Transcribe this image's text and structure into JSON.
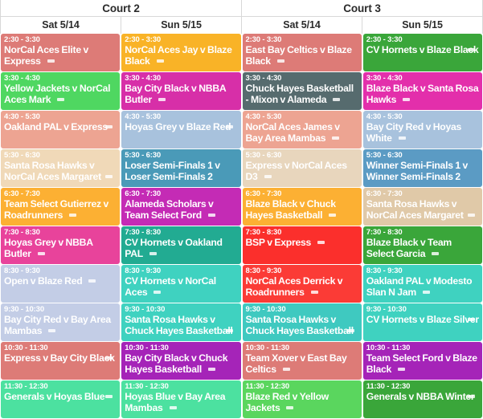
{
  "courts": [
    {
      "name": "Court 2"
    },
    {
      "name": "Court 3"
    }
  ],
  "days": [
    {
      "label": "Sat 5/14"
    },
    {
      "label": "Sun 5/15"
    },
    {
      "label": "Sat 5/14"
    },
    {
      "label": "Sun 5/15"
    }
  ],
  "marker_symbol": "=",
  "columns": [
    {
      "court": "Court 2",
      "day": "Sat 5/14",
      "games": [
        {
          "time": "2:30 - 3:30",
          "title": "NorCal Aces Elite v Express",
          "color": "#dd7b77",
          "marker": true
        },
        {
          "time": "3:30 - 4:30",
          "title": "Yellow Jackets v NorCal Aces Mark",
          "color": "#4fd761",
          "marker": true
        },
        {
          "time": "4:30 - 5:30",
          "title": "Oakland PAL v Express",
          "color": "#eda492",
          "marker": true
        },
        {
          "time": "5:30 - 6:30",
          "title": "Santa Rosa Hawks v NorCal Aces Margaret",
          "color": "#f0d9b8",
          "marker": true
        },
        {
          "time": "6:30 - 7:30",
          "title": "Team Select Gutierrez v Roadrunners",
          "color": "#fcb033",
          "marker": true
        },
        {
          "time": "7:30 - 8:30",
          "title": "Hoyas Grey v NBBA Butler",
          "color": "#e8439b",
          "marker": true
        },
        {
          "time": "8:30 - 9:30",
          "title": "Open v Blaze Red",
          "color": "#c3cde6",
          "marker": true
        },
        {
          "time": "9:30 - 10:30",
          "title": "Bay City Red v Bay Area Mambas",
          "color": "#c3cde6",
          "marker": true
        },
        {
          "time": "10:30 - 11:30",
          "title": "Express v Bay City Black",
          "color": "#dd7b77",
          "marker": true
        },
        {
          "time": "11:30 - 12:30",
          "title": "Generals v Hoyas Blue",
          "color": "#4ce1a0",
          "marker": true
        }
      ]
    },
    {
      "court": "Court 2",
      "day": "Sun 5/15",
      "games": [
        {
          "time": "2:30 - 3:30",
          "title": "NorCal Aces Jay v Blaze Black",
          "color": "#f9b327",
          "marker": true
        },
        {
          "time": "3:30 - 4:30",
          "title": "Bay City Black v NBBA Butler",
          "color": "#d72fa8",
          "marker": true
        },
        {
          "time": "4:30 - 5:30",
          "title": "Hoyas Grey v Blaze Red",
          "color": "#a8c2dd",
          "marker": true
        },
        {
          "time": "5:30 - 6:30",
          "title": "Loser Semi-Finals 1 v Loser Semi-Finals 2",
          "color": "#4a9ab8",
          "marker": false
        },
        {
          "time": "6:30 - 7:30",
          "title": "Alameda Scholars v Team Select Ford",
          "color": "#c42bb5",
          "marker": true
        },
        {
          "time": "7:30 - 8:30",
          "title": "CV Hornets v Oakland PAL",
          "color": "#22ab92",
          "marker": true
        },
        {
          "time": "8:30 - 9:30",
          "title": "CV Hornets v NorCal Aces",
          "color": "#3fd2c0",
          "marker": true
        },
        {
          "time": "9:30 - 10:30",
          "title": "Santa Rosa Hawks v Chuck Hayes Basketball",
          "color": "#3fd2c0",
          "marker": true
        },
        {
          "time": "10:30 - 11:30",
          "title": "Bay City Black v Chuck Hayes Basketball",
          "color": "#a524b8",
          "marker": true
        },
        {
          "time": "11:30 - 12:30",
          "title": "Hoyas Blue v Bay Area Mambas",
          "color": "#4ce1a0",
          "marker": true
        }
      ]
    },
    {
      "court": "Court 3",
      "day": "Sat 5/14",
      "games": [
        {
          "time": "2:30 - 3:30",
          "title": "East Bay Celtics v Blaze Black",
          "color": "#dd7b77",
          "marker": true
        },
        {
          "time": "3:30 - 4:30",
          "title": "Chuck Hayes Basketball - Mixon v Alameda",
          "color": "#566b6e",
          "marker": true
        },
        {
          "time": "4:30 - 5:30",
          "title": "NorCal Aces James v Bay Area Mambas",
          "color": "#eda492",
          "marker": true
        },
        {
          "time": "5:30 - 6:30",
          "title": "Express v NorCal Aces D3",
          "color": "#e8d6bd",
          "marker": true
        },
        {
          "time": "6:30 - 7:30",
          "title": "Blaze Black v Chuck Hayes Basketball",
          "color": "#fcb033",
          "marker": true
        },
        {
          "time": "7:30 - 8:30",
          "title": "BSP v Express",
          "color": "#fb2f2c",
          "marker": true
        },
        {
          "time": "8:30 - 9:30",
          "title": "NorCal Aces Derrick v Roadrunners",
          "color": "#fb3b36",
          "marker": true
        },
        {
          "time": "9:30 - 10:30",
          "title": "Santa Rosa Hawks v Chuck Hayes Basketball",
          "color": "#3fc9c0",
          "marker": true
        },
        {
          "time": "10:30 - 11:30",
          "title": "Team Xover v East Bay Celtics",
          "color": "#dd7b77",
          "marker": true
        },
        {
          "time": "11:30 - 12:30",
          "title": "Blaze Red v Yellow Jackets",
          "color": "#5ad65e",
          "marker": true
        }
      ]
    },
    {
      "court": "Court 3",
      "day": "Sun 5/15",
      "games": [
        {
          "time": "2:30 - 3:30",
          "title": "CV Hornets v Blaze Black",
          "color": "#3aa63a",
          "marker": true
        },
        {
          "time": "3:30 - 4:30",
          "title": "Blaze Black v Santa Rosa Hawks",
          "color": "#e32fab",
          "marker": true
        },
        {
          "time": "4:30 - 5:30",
          "title": "Bay City Red v Hoyas White",
          "color": "#a8c2dd",
          "marker": true
        },
        {
          "time": "5:30 - 6:30",
          "title": "Winner Semi-Finals 1 v Winner Semi-Finals 2",
          "color": "#5b9bc4",
          "marker": false
        },
        {
          "time": "6:30 - 7:30",
          "title": "Santa Rosa Hawks v NorCal Aces Margaret",
          "color": "#e0c9a8",
          "marker": true
        },
        {
          "time": "7:30 - 8:30",
          "title": "Blaze Black v Team Select Garcia",
          "color": "#3aa63a",
          "marker": true
        },
        {
          "time": "8:30 - 9:30",
          "title": "Oakland PAL v Modesto Slan N Jam",
          "color": "#3fd2c0",
          "marker": true
        },
        {
          "time": "9:30 - 10:30",
          "title": "CV Hornets v Blaze Silver",
          "color": "#3fd2c0",
          "marker": true
        },
        {
          "time": "10:30 - 11:30",
          "title": "Team Select Ford v Blaze Black",
          "color": "#a524b8",
          "marker": true
        },
        {
          "time": "11:30 - 12:30",
          "title": "Generals v NBBA Winter",
          "color": "#3aa63a",
          "marker": true
        }
      ]
    }
  ]
}
